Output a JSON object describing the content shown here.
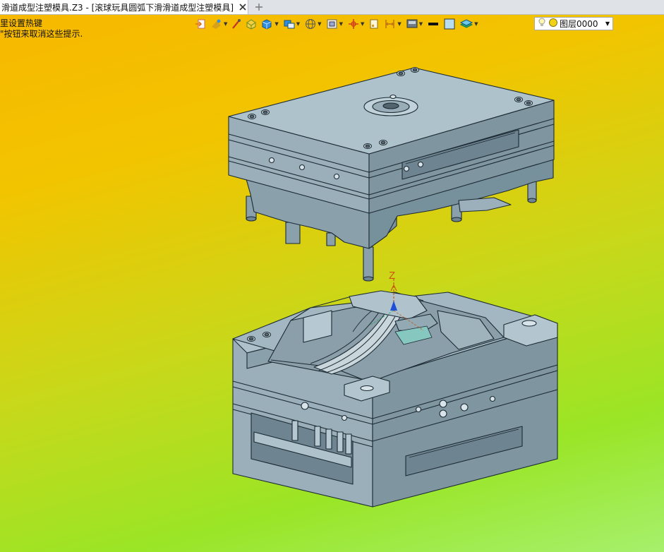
{
  "tab": {
    "title": "滑道成型注塑模具.Z3 - [滚球玩具圆弧下滑滑道成型注塑模具]",
    "close_icon": "close-icon",
    "add_icon": "plus-icon"
  },
  "hint": {
    "line1": "里设置热键",
    "line2": "\"按钮来取消这些提示."
  },
  "toolbar": {
    "tools": [
      "exit-sketch-icon",
      "paint-icon",
      "brush-icon",
      "shaded-face-icon",
      "solid-cube-icon",
      "view-orient-icon",
      "sphere-wire-icon",
      "zoom-fit-icon",
      "datum-axis-icon",
      "page-icon",
      "dimension-icon",
      "display-mode-icon",
      "line-color-icon",
      "face-color-icon",
      "layer-stack-icon"
    ]
  },
  "layer": {
    "label": "图层0000",
    "bulb_icon": "bulb-icon",
    "state_icon": "layer-state-icon"
  },
  "triad": {
    "axis_label": "Z"
  },
  "colors": {
    "mold": "#8aa0ab",
    "mold_top": "#a8bcc6",
    "edge": "#1c2a33",
    "axis": "#c8580f"
  }
}
